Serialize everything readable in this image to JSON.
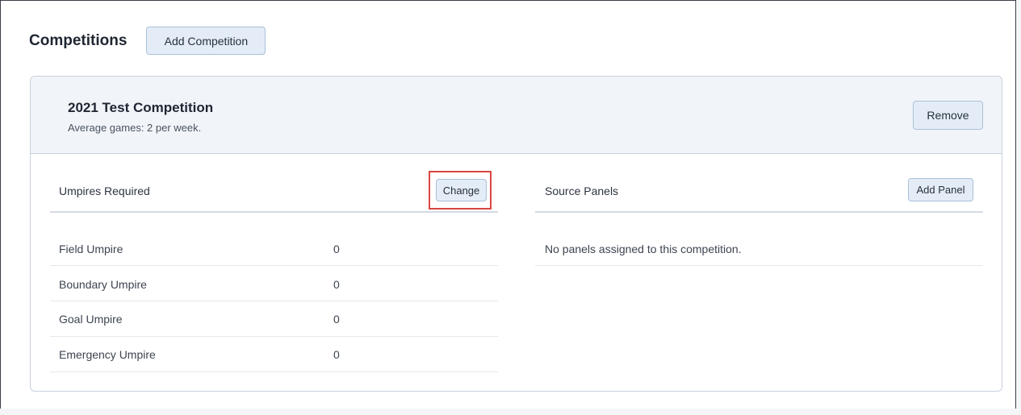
{
  "header": {
    "title": "Competitions",
    "add_competition_label": "Add Competition"
  },
  "competition": {
    "name": "2021 Test Competition",
    "subtitle": "Average games: 2 per week.",
    "remove_label": "Remove",
    "umpires": {
      "title": "Umpires Required",
      "change_label": "Change",
      "rows": [
        {
          "role": "Field Umpire",
          "count": "0"
        },
        {
          "role": "Boundary Umpire",
          "count": "0"
        },
        {
          "role": "Goal Umpire",
          "count": "0"
        },
        {
          "role": "Emergency Umpire",
          "count": "0"
        }
      ]
    },
    "panels": {
      "title": "Source Panels",
      "add_panel_label": "Add Panel",
      "empty_message": "No panels assigned to this competition."
    }
  },
  "colors": {
    "button_bg": "#e4edf7",
    "button_border": "#a9bfd6",
    "highlight": "#d9463f",
    "card_header_bg": "#f1f5fa"
  }
}
